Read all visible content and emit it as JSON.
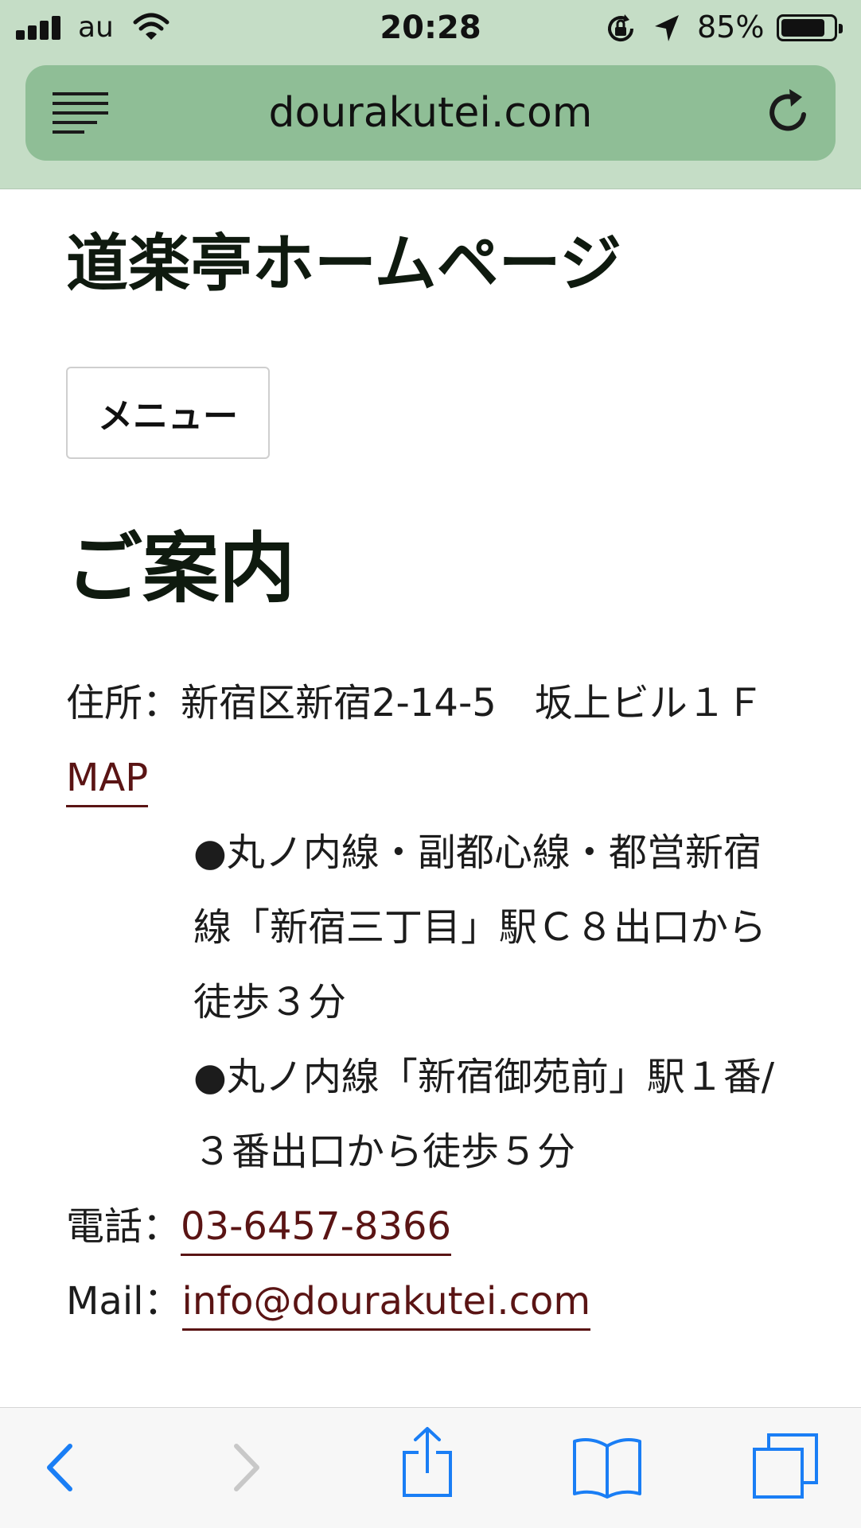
{
  "status_bar": {
    "carrier": "au",
    "time": "20:28",
    "battery_percent": "85%",
    "battery_level": 0.85
  },
  "browser": {
    "url": "dourakutei.com"
  },
  "page": {
    "site_title": "道楽亭ホームページ",
    "menu_button": "メニュー",
    "section_title": "ご案内",
    "address_label": "住所：",
    "address_text": "新宿区新宿2-14-5　坂上ビル１Ｆ　",
    "map_link": "MAP",
    "access_1": "●丸ノ内線・副都心線・都営新宿線「新宿三丁目」駅Ｃ８出口から徒歩３分",
    "access_2": "●丸ノ内線「新宿御苑前」駅１番/３番出口から徒歩５分",
    "phone_label": "電話：",
    "phone": "03-6457-8366",
    "mail_label": "Mail：",
    "mail": "info@dourakutei.com"
  },
  "icons": {
    "back": "back-arrow-icon",
    "forward": "forward-arrow-icon",
    "share": "share-icon",
    "bookmarks": "bookmarks-icon",
    "tabs": "tabs-icon"
  },
  "colors": {
    "chrome_bg": "#c5ddc6",
    "urlbar_bg": "#8fbe96",
    "link": "#5a1414",
    "toolbar_icon": "#1a7ef5"
  }
}
